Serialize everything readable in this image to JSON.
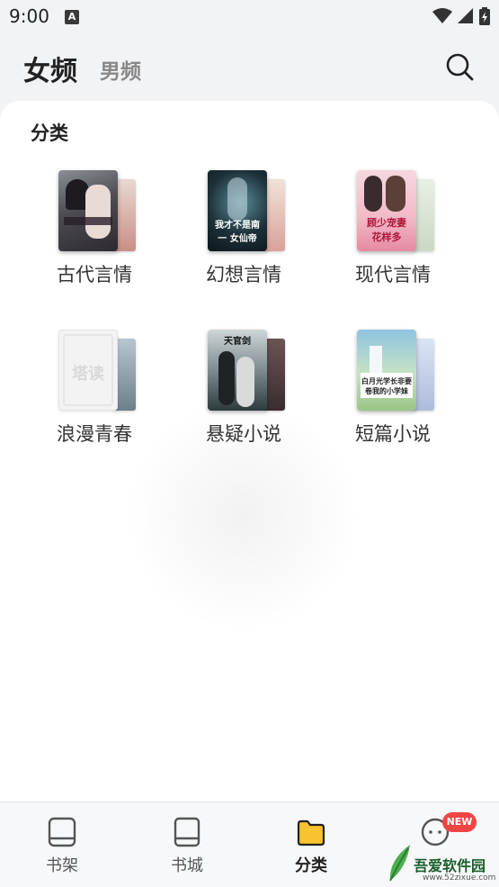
{
  "status_bar": {
    "time": "9:00",
    "notification_icon": "A"
  },
  "header": {
    "tabs": [
      {
        "label": "女频",
        "active": true
      },
      {
        "label": "男频",
        "active": false
      }
    ],
    "search_icon": "search-icon"
  },
  "section": {
    "title": "分类"
  },
  "categories": [
    {
      "label": "古代言情",
      "cover_text": ""
    },
    {
      "label": "幻想言情",
      "cover_text": "我才不是南一 女仙帝"
    },
    {
      "label": "现代言情",
      "cover_text": "顾少宠妻 花样多"
    },
    {
      "label": "浪漫青春",
      "cover_text": "塔读"
    },
    {
      "label": "悬疑小说",
      "cover_text": "天官剑"
    },
    {
      "label": "短篇小说",
      "cover_text": "白月光学长非要 卷我的小学妹"
    }
  ],
  "bottom_nav": {
    "items": [
      {
        "label": "书架",
        "icon": "bookshelf-icon"
      },
      {
        "label": "书城",
        "icon": "bookstore-icon"
      },
      {
        "label": "分类",
        "icon": "folder-icon",
        "active": true
      },
      {
        "label": "",
        "icon": "chat-icon"
      }
    ],
    "badge": "NEW"
  },
  "watermark": {
    "title": "吾爱软件园",
    "url": "www.52zixue.com"
  },
  "colors": {
    "accent": "#f7c32e",
    "badge": "#f04545"
  }
}
